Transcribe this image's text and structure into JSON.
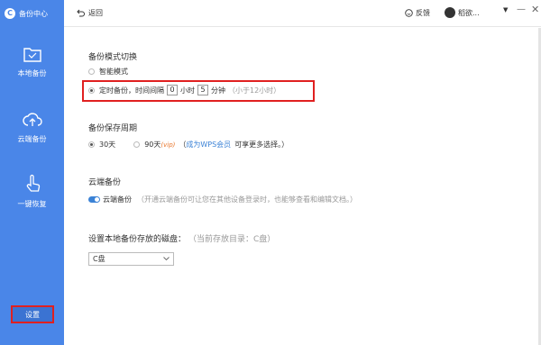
{
  "sidebar": {
    "app_title": "备份中心",
    "logo_glyph": "C",
    "items": [
      {
        "label": "本地备份",
        "icon": "folder-icon"
      },
      {
        "label": "云端备份",
        "icon": "cloud-upload-icon"
      },
      {
        "label": "一键恢复",
        "icon": "hand-pointer-icon"
      }
    ],
    "settings_label": "设置"
  },
  "topbar": {
    "back_label": "返回",
    "feedback_label": "反馈",
    "user_name": "稻欲..."
  },
  "backup_mode": {
    "title": "备份模式切换",
    "smart_label": "智能模式",
    "scheduled_label": "定时备份，时间间隔",
    "hours_value": "0",
    "hours_unit": "小时",
    "minutes_value": "5",
    "minutes_unit": "分钟",
    "hint": "（小于12小时）",
    "selected": "scheduled"
  },
  "retention": {
    "title": "备份保存周期",
    "option_30": "30天",
    "option_90": "90天",
    "vip_tag": "(vip)",
    "paren_open": "（",
    "member_link": "成为WPS会员",
    "member_suffix": "可享更多选择。）",
    "selected": "30"
  },
  "cloud_backup": {
    "title": "云端备份",
    "toggle_label": "云端备份",
    "description": "（开通云端备份可让您在其他设备登录时，也能够查看和编辑文档。）",
    "enabled": true
  },
  "local_disk": {
    "title": "设置本地备份存放的磁盘：",
    "current": "（当前存放目录：C盘）",
    "selected_disk": "C盘"
  },
  "colors": {
    "sidebar_bg": "#4a86e8",
    "highlight": "#e02020",
    "link": "#3b82d6",
    "vip": "#e8762c"
  }
}
